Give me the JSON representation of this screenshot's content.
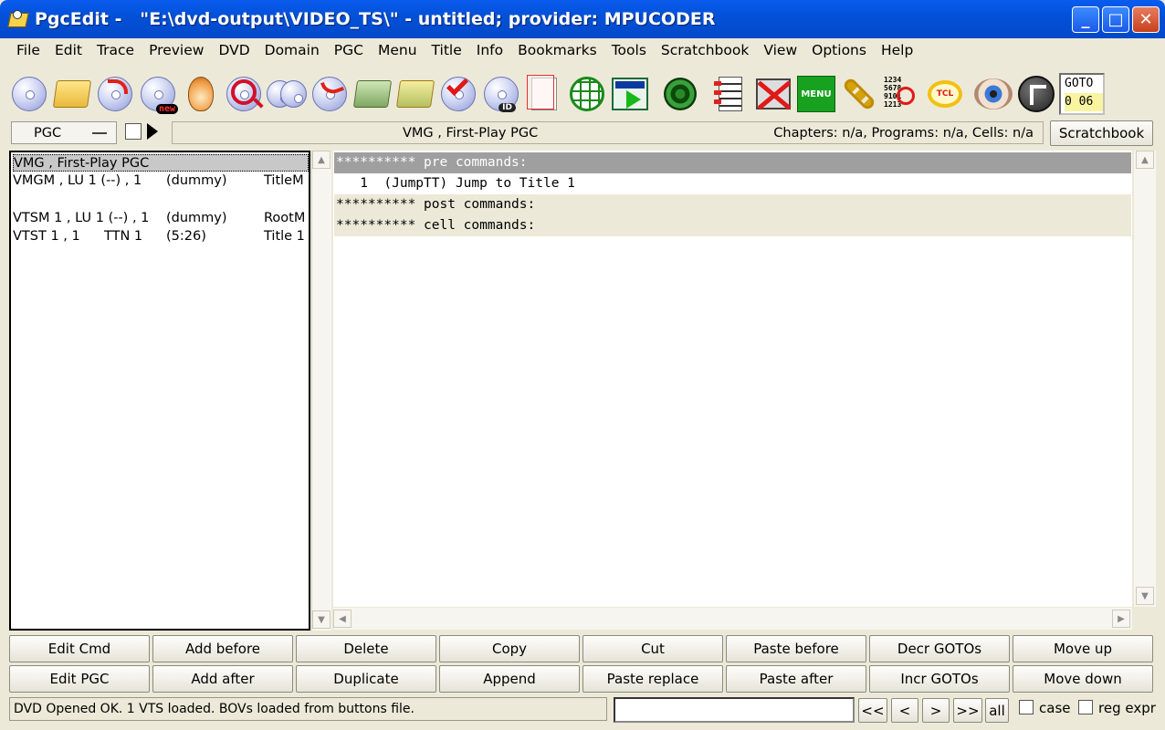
{
  "window": {
    "title": "PgcEdit -   \"E:\\dvd-output\\VIDEO_TS\\\" - untitled; provider: MPUCODER",
    "minimize": "_",
    "maximize": "□",
    "close": "✕"
  },
  "menu": [
    "File",
    "Edit",
    "Trace",
    "Preview",
    "DVD",
    "Domain",
    "PGC",
    "Menu",
    "Title",
    "Info",
    "Bookmarks",
    "Tools",
    "Scratchbook",
    "View",
    "Options",
    "Help"
  ],
  "toolbar": {
    "icons": [
      "open-dvd-disc-icon",
      "open-folder-icon",
      "reload-disc-icon",
      "new-disc-icon",
      "onion-icon",
      "search-disc-icon",
      "multi-disc-icon",
      "jump-disc-icon",
      "save-as-icon",
      "save-folder-icon",
      "check-disc-icon",
      "disc-id-icon",
      "copy-document-icon",
      "globe-icon",
      "play-preview-icon",
      "film-reel-icon",
      "checklist-icon",
      "no-film-icon",
      "menu-icon",
      "chain-icon",
      "numbers-search-icon",
      "tcl-icon",
      "eye-icon",
      "navigate-arrow-icon"
    ],
    "new_badge": "new",
    "id_badge": "ID",
    "menu_label": "MENU",
    "numbers_label": [
      "1234",
      "5678",
      "9101",
      "1213"
    ],
    "tcl_label": "TCL",
    "goto_label": "GOTO",
    "goto_value": "0 06"
  },
  "pgc_selector": "PGC",
  "current_pgc": "VMG , First-Play PGC",
  "counts": "Chapters: n/a,  Programs: n/a,  Cells: n/a",
  "scratchbook_button": "Scratchbook",
  "pgc_list": [
    {
      "c1": "VMG , First-Play PGC",
      "c2": "",
      "c3": "",
      "c4": "",
      "selected": true
    },
    {
      "c1": "VMGM , LU 1 (--) , 1",
      "c2": "",
      "c3": "(dummy)",
      "c4": "TitleM",
      "selected": false
    },
    {
      "c1": "",
      "c2": "",
      "c3": "",
      "c4": "",
      "selected": false
    },
    {
      "c1": "VTSM 1 , LU 1 (--) , 1",
      "c2": "",
      "c3": "(dummy)",
      "c4": "RootM",
      "selected": false
    },
    {
      "c1": "VTST 1 , 1",
      "c2": "TTN 1",
      "c3": "(5:26)",
      "c4": "Title 1",
      "selected": false
    }
  ],
  "commands": [
    {
      "text": "********** pre commands:",
      "kind": "hl"
    },
    {
      "text": "   1  (JumpTT) Jump to Title 1",
      "kind": "cmd"
    },
    {
      "text": "********** post commands:",
      "kind": "sect"
    },
    {
      "text": "********** cell commands:",
      "kind": "sect"
    }
  ],
  "buttons_row1": [
    "Edit Cmd",
    "Add before",
    "Delete",
    "Copy",
    "Cut",
    "Paste before",
    "Decr GOTOs",
    "Move up"
  ],
  "buttons_row2": [
    "Edit PGC",
    "Add after",
    "Duplicate",
    "Append",
    "Paste replace",
    "Paste after",
    "Incr GOTOs",
    "Move down"
  ],
  "status": "DVD Opened OK.  1 VTS loaded.  BOVs loaded from buttons file.",
  "search": {
    "value": "",
    "nav": [
      "<<",
      "<",
      ">",
      ">>",
      "all"
    ],
    "case_label": "case",
    "regex_label": "reg expr"
  }
}
